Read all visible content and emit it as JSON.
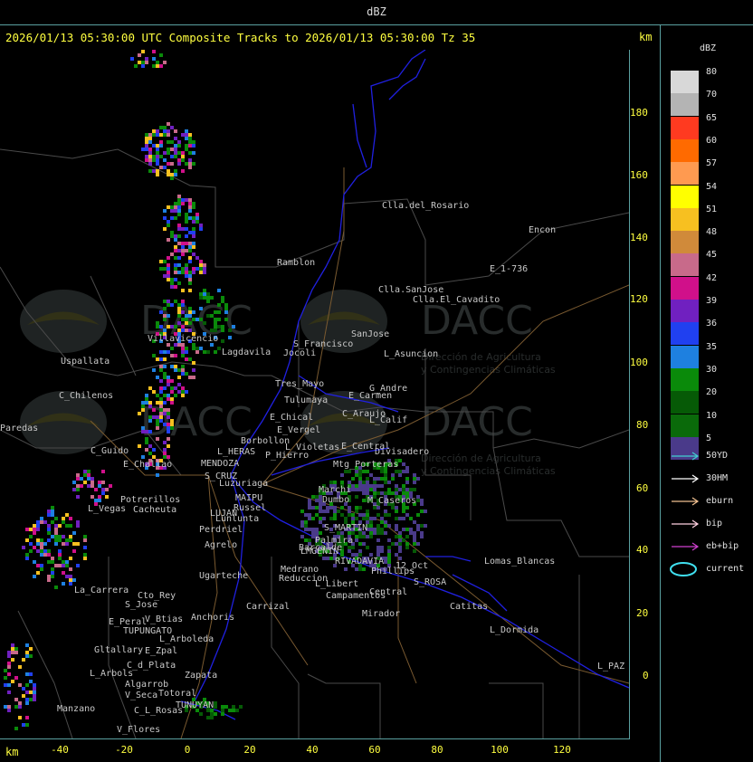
{
  "window": {
    "title": "dBZ"
  },
  "header": {
    "line": "2026/01/13 05:30:00 UTC Composite Tracks to 2026/01/13 05:30:00 Tz 35",
    "km_top": "km",
    "km_bottom": "km"
  },
  "axes": {
    "y_ticks": [
      "180",
      "160",
      "140",
      "120",
      "100",
      "80",
      "60",
      "40",
      "20",
      "0"
    ],
    "x_ticks": [
      "-40",
      "-20",
      "0",
      "20",
      "40",
      "60",
      "80",
      "100",
      "120"
    ]
  },
  "legend": {
    "title": "dBZ",
    "levels": [
      {
        "label": "80",
        "color": "#d8d8d8"
      },
      {
        "label": "70",
        "color": "#b4b4b4"
      },
      {
        "label": "65",
        "color": "#ff3a20"
      },
      {
        "label": "60",
        "color": "#ff6a00"
      },
      {
        "label": "57",
        "color": "#ff9a50"
      },
      {
        "label": "54",
        "color": "#ffff00"
      },
      {
        "label": "51",
        "color": "#f7c020"
      },
      {
        "label": "48",
        "color": "#d08a3a"
      },
      {
        "label": "45",
        "color": "#c86a8a"
      },
      {
        "label": "42",
        "color": "#d0108a"
      },
      {
        "label": "39",
        "color": "#7020c0"
      },
      {
        "label": "36",
        "color": "#2040f0"
      },
      {
        "label": "35",
        "color": "#1e80e0"
      },
      {
        "label": "30",
        "color": "#0a8a0a"
      },
      {
        "label": "20",
        "color": "#065a06"
      },
      {
        "label": "10",
        "color": "#0a6a0a"
      },
      {
        "label": "5",
        "color": "#4a3a8a"
      }
    ],
    "tracks": [
      {
        "label": "50YD",
        "color": "#40d0d0"
      },
      {
        "label": "30HM",
        "color": "#ffffff"
      },
      {
        "label": "eburn",
        "color": "#f0c090"
      },
      {
        "label": "bip",
        "color": "#ffd0e0"
      },
      {
        "label": "eb+bip",
        "color": "#d040d0"
      },
      {
        "label": "current",
        "color": "#40e0f0"
      }
    ]
  },
  "watermark": {
    "brand": "DACC",
    "line1": "Dirección de Agricultura",
    "line2": "y Contingencias Climáticas"
  },
  "places": [
    "Clla.del_Rosario",
    "Encon",
    "Ramblon",
    "E_1-736",
    "Clla.SanJose",
    "Clla.El_Cavadito",
    "Villavicencio",
    "Uspallata",
    "S_Francisco",
    "SanJose",
    "L_Asuncion",
    "Jocoli",
    "Tres_Mayo",
    "Lagdavila",
    "Tulumaya",
    "E_Carmen",
    "G_Andre",
    "C_Chilenos",
    "E_Chical",
    "C_Araujo",
    "L_Calif",
    "E_Vergel",
    "Borbollon",
    "L_Violetas",
    "E_Central",
    "Divisadero",
    "C_Guido",
    "P_Hierro",
    "L_HERAS",
    "E_Challao",
    "MENDOZA",
    "Mtg_Porteras",
    "S_CRUZ",
    "Luzuriaga",
    "Potrerillos",
    "L_Vegas",
    "Cacheuta",
    "MAIPU",
    "Russel",
    "LUJAN",
    "Lunlunta",
    "Perdriel",
    "Agrelo",
    "Ugarteche",
    "Medrano",
    "Reduccion",
    "L_Libert",
    "Campamentos",
    "RIVADAVIA",
    "Phillips",
    "12_Oct",
    "S_ROSA",
    "Catitas",
    "Lomas_Blancas",
    "Central",
    "Mirador",
    "L_Dormida",
    "L_PAZ",
    "Carrizal",
    "La_Carrera",
    "Cto_Rey",
    "S_Jose",
    "E_Peral",
    "V_Btias",
    "Anchoris",
    "TUPUNGATO",
    "L_Arboleda",
    "Gltallary",
    "E_Zpal",
    "L_Arbols",
    "C_d_Plata",
    "Algarrob",
    "Zapata",
    "V_Seca",
    "Totoral",
    "Manzano",
    "C_L_Rosas",
    "TUNUYAN",
    "V_Flores",
    "Paredas",
    "S_MARTIN",
    "Palmira",
    "Barcalde",
    "Dumbo",
    "M_Caseros",
    "Marchi",
    "LMGENIN"
  ]
}
